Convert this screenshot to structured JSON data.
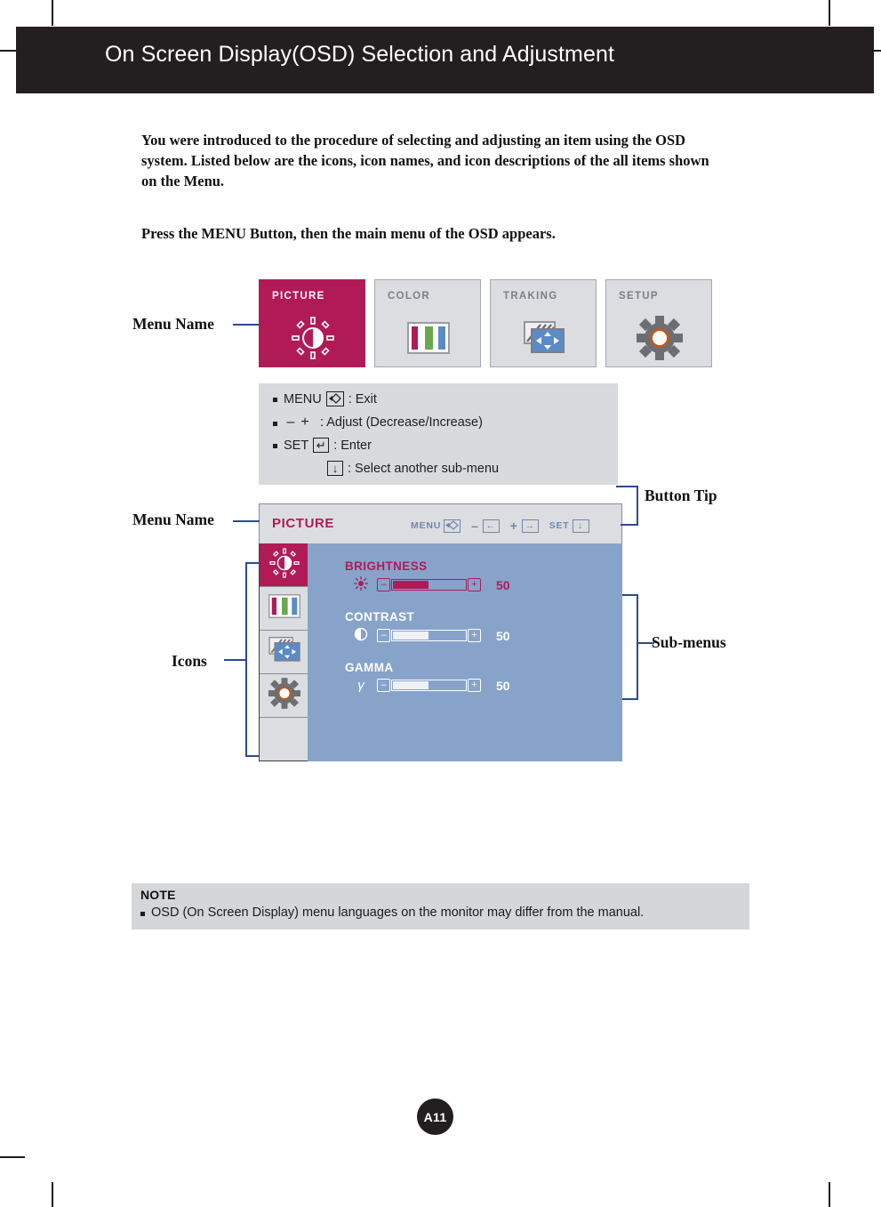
{
  "page": {
    "header_title": "On Screen Display(OSD) Selection and Adjustment",
    "badge": "A11"
  },
  "intro": {
    "paragraph_1": "You were introduced to the procedure of selecting and adjusting an item using the OSD system.  Listed below are the icons, icon names, and icon descriptions of the all items shown on the Menu.",
    "paragraph_2": "Press the MENU Button, then the main menu of the OSD appears."
  },
  "menu_tabs": [
    {
      "label": "PICTURE",
      "icon": "brightness-icon",
      "active": true
    },
    {
      "label": "COLOR",
      "icon": "color-bars-icon",
      "active": false
    },
    {
      "label": "TRAKING",
      "icon": "tracking-icon",
      "active": false
    },
    {
      "label": "SETUP",
      "icon": "gear-icon",
      "active": false
    }
  ],
  "button_tip": {
    "row_1": {
      "key": "MENU",
      "glyph": "◇",
      "sep": ": Exit"
    },
    "row_2": {
      "minus": "–",
      "plus": "+",
      "sep": ": Adjust (Decrease/Increase)"
    },
    "row_3": {
      "key": "SET",
      "glyph": "↵",
      "sep": ": Enter"
    },
    "row_4": {
      "glyph": "↓",
      "sep": ": Select another sub-menu"
    }
  },
  "osd": {
    "title": "PICTURE",
    "hotkeys": [
      {
        "label": "MENU",
        "glyph": "◇"
      },
      {
        "label": "–",
        "glyph": "←"
      },
      {
        "label": "+",
        "glyph": "→"
      },
      {
        "label": "SET",
        "glyph": "↓"
      }
    ],
    "sidebar_icons": [
      "brightness-icon",
      "color-bars-icon",
      "tracking-icon",
      "gear-icon",
      "empty"
    ],
    "submenus": [
      {
        "label": "BRIGHTNESS",
        "icon": "sun-icon",
        "value": "50",
        "percent": 50,
        "active": true
      },
      {
        "label": "CONTRAST",
        "icon": "contrast-circle-icon",
        "value": "50",
        "percent": 50,
        "active": false
      },
      {
        "label": "GAMMA",
        "icon": "gamma-icon",
        "value": "50",
        "percent": 50,
        "active": false
      }
    ],
    "minus_label": "–",
    "plus_label": "+"
  },
  "annotations": {
    "menu_name_top": "Menu Name",
    "menu_name_bottom": "Menu Name",
    "icons": "Icons",
    "button_tip": "Button Tip",
    "sub_menus": "Sub-menus"
  },
  "note": {
    "title": "NOTE",
    "text": "OSD (On Screen Display) menu languages on the monitor may differ from the manual."
  },
  "colors": {
    "crimson": "#b01b57",
    "panel_blue": "#87a3ca",
    "banner_black": "#231f20",
    "tab_gray": "#dcdde1",
    "connector_blue": "#2b4b8f"
  }
}
